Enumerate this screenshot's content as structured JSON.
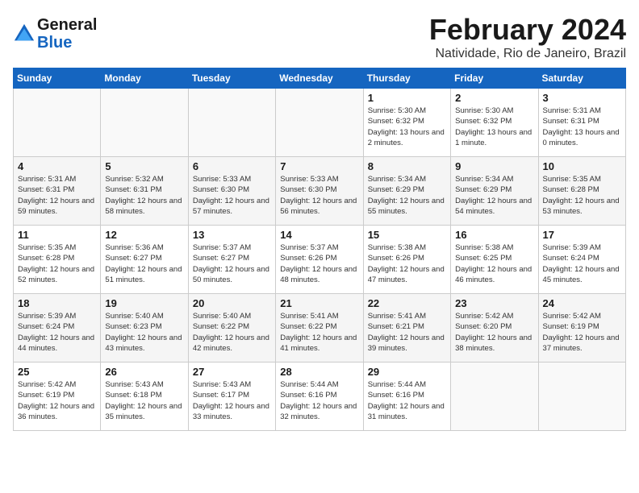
{
  "header": {
    "logo_general": "General",
    "logo_blue": "Blue",
    "month_title": "February 2024",
    "location": "Natividade, Rio de Janeiro, Brazil"
  },
  "days_of_week": [
    "Sunday",
    "Monday",
    "Tuesday",
    "Wednesday",
    "Thursday",
    "Friday",
    "Saturday"
  ],
  "weeks": [
    [
      {
        "day": "",
        "empty": true
      },
      {
        "day": "",
        "empty": true
      },
      {
        "day": "",
        "empty": true
      },
      {
        "day": "",
        "empty": true
      },
      {
        "day": "1",
        "sunrise": "5:30 AM",
        "sunset": "6:32 PM",
        "daylight": "13 hours and 2 minutes."
      },
      {
        "day": "2",
        "sunrise": "5:30 AM",
        "sunset": "6:32 PM",
        "daylight": "13 hours and 1 minute."
      },
      {
        "day": "3",
        "sunrise": "5:31 AM",
        "sunset": "6:31 PM",
        "daylight": "13 hours and 0 minutes."
      }
    ],
    [
      {
        "day": "4",
        "sunrise": "5:31 AM",
        "sunset": "6:31 PM",
        "daylight": "12 hours and 59 minutes."
      },
      {
        "day": "5",
        "sunrise": "5:32 AM",
        "sunset": "6:31 PM",
        "daylight": "12 hours and 58 minutes."
      },
      {
        "day": "6",
        "sunrise": "5:33 AM",
        "sunset": "6:30 PM",
        "daylight": "12 hours and 57 minutes."
      },
      {
        "day": "7",
        "sunrise": "5:33 AM",
        "sunset": "6:30 PM",
        "daylight": "12 hours and 56 minutes."
      },
      {
        "day": "8",
        "sunrise": "5:34 AM",
        "sunset": "6:29 PM",
        "daylight": "12 hours and 55 minutes."
      },
      {
        "day": "9",
        "sunrise": "5:34 AM",
        "sunset": "6:29 PM",
        "daylight": "12 hours and 54 minutes."
      },
      {
        "day": "10",
        "sunrise": "5:35 AM",
        "sunset": "6:28 PM",
        "daylight": "12 hours and 53 minutes."
      }
    ],
    [
      {
        "day": "11",
        "sunrise": "5:35 AM",
        "sunset": "6:28 PM",
        "daylight": "12 hours and 52 minutes."
      },
      {
        "day": "12",
        "sunrise": "5:36 AM",
        "sunset": "6:27 PM",
        "daylight": "12 hours and 51 minutes."
      },
      {
        "day": "13",
        "sunrise": "5:37 AM",
        "sunset": "6:27 PM",
        "daylight": "12 hours and 50 minutes."
      },
      {
        "day": "14",
        "sunrise": "5:37 AM",
        "sunset": "6:26 PM",
        "daylight": "12 hours and 48 minutes."
      },
      {
        "day": "15",
        "sunrise": "5:38 AM",
        "sunset": "6:26 PM",
        "daylight": "12 hours and 47 minutes."
      },
      {
        "day": "16",
        "sunrise": "5:38 AM",
        "sunset": "6:25 PM",
        "daylight": "12 hours and 46 minutes."
      },
      {
        "day": "17",
        "sunrise": "5:39 AM",
        "sunset": "6:24 PM",
        "daylight": "12 hours and 45 minutes."
      }
    ],
    [
      {
        "day": "18",
        "sunrise": "5:39 AM",
        "sunset": "6:24 PM",
        "daylight": "12 hours and 44 minutes."
      },
      {
        "day": "19",
        "sunrise": "5:40 AM",
        "sunset": "6:23 PM",
        "daylight": "12 hours and 43 minutes."
      },
      {
        "day": "20",
        "sunrise": "5:40 AM",
        "sunset": "6:22 PM",
        "daylight": "12 hours and 42 minutes."
      },
      {
        "day": "21",
        "sunrise": "5:41 AM",
        "sunset": "6:22 PM",
        "daylight": "12 hours and 41 minutes."
      },
      {
        "day": "22",
        "sunrise": "5:41 AM",
        "sunset": "6:21 PM",
        "daylight": "12 hours and 39 minutes."
      },
      {
        "day": "23",
        "sunrise": "5:42 AM",
        "sunset": "6:20 PM",
        "daylight": "12 hours and 38 minutes."
      },
      {
        "day": "24",
        "sunrise": "5:42 AM",
        "sunset": "6:19 PM",
        "daylight": "12 hours and 37 minutes."
      }
    ],
    [
      {
        "day": "25",
        "sunrise": "5:42 AM",
        "sunset": "6:19 PM",
        "daylight": "12 hours and 36 minutes."
      },
      {
        "day": "26",
        "sunrise": "5:43 AM",
        "sunset": "6:18 PM",
        "daylight": "12 hours and 35 minutes."
      },
      {
        "day": "27",
        "sunrise": "5:43 AM",
        "sunset": "6:17 PM",
        "daylight": "12 hours and 33 minutes."
      },
      {
        "day": "28",
        "sunrise": "5:44 AM",
        "sunset": "6:16 PM",
        "daylight": "12 hours and 32 minutes."
      },
      {
        "day": "29",
        "sunrise": "5:44 AM",
        "sunset": "6:16 PM",
        "daylight": "12 hours and 31 minutes."
      },
      {
        "day": "",
        "empty": true
      },
      {
        "day": "",
        "empty": true
      }
    ]
  ]
}
